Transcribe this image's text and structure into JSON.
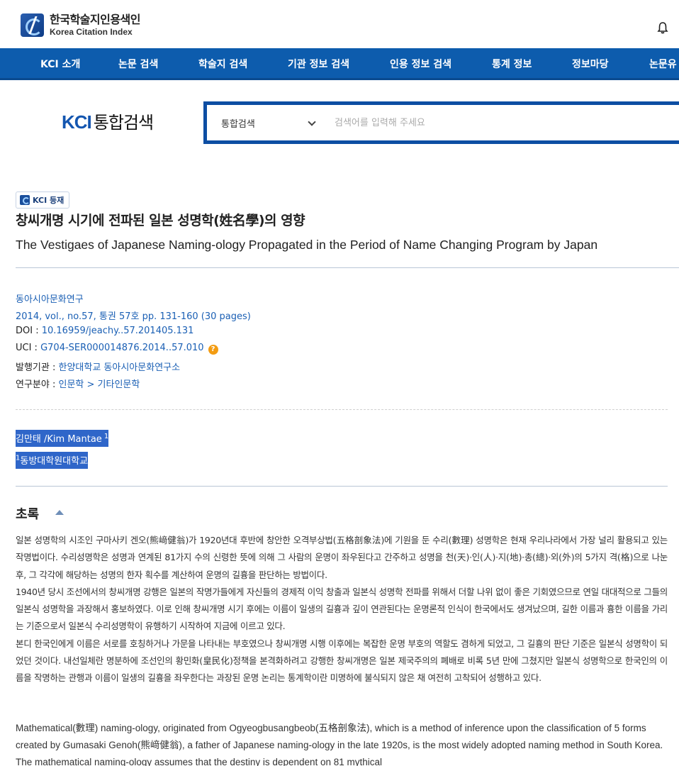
{
  "header": {
    "logo_ko": "한국학술지인용색인",
    "logo_en": "Korea Citation Index"
  },
  "nav": {
    "items": [
      "KCI 소개",
      "논문 검색",
      "학술지 검색",
      "기관 정보 검색",
      "인용 정보 검색",
      "통계 정보",
      "정보마당",
      "논문유"
    ]
  },
  "search": {
    "logo_kci": "KCI",
    "logo_text": "통합검색",
    "select_value": "통합검색",
    "placeholder": "검색어를 입력해 주세요"
  },
  "article": {
    "badge": "KCI 등재",
    "title_ko": "창씨개명 시기에 전파된 일본 성명학(姓名學)의 영향",
    "title_en": "The Vestigaes of Japanese Naming-ology Propagated in the Period of Name Changing Program by Japan",
    "journal": "동아시아문화연구",
    "issue": "2014, vol., no.57, 통권 57호 pp. 131-160 (30 pages)",
    "doi_label": "DOI : ",
    "doi": "10.16959/jeachy..57.201405.131",
    "uci_label": "UCI : ",
    "uci": "G704-SER000014876.2014..57.010",
    "publisher_label": "발행기관 : ",
    "publisher": "한양대학교 동아시아문화연구소",
    "field_label": "연구분야 : ",
    "field": "인문학 > 기타인문학",
    "author": "김만태 /Kim Mantae",
    "author_sup": "1",
    "affil_sup": "1",
    "affiliation": "동방대학원대학교"
  },
  "abstract": {
    "heading": "초록",
    "ko_p1": "일본 성명학의 시조인 구마사키 겐오(熊﨑健翁)가 1920년대 후반에 창안한 오격부상법(五格剖象法)에 기원을 둔 수리(數理) 성명학은 현재 우리나라에서 가장 널리 활용되고 있는 작명법이다. 수리성명학은 성명과 연계된 81가지 수의 신령한 뜻에 의해 그 사람의 운명이 좌우된다고 간주하고 성명을 천(天)·인(人)·지(地)·총(總)·외(外)의 5가지 격(格)으로 나눈 후, 그 각각에 해당하는 성명의 한자 획수를 계산하여 운명의 길흉을 판단하는 방법이다.",
    "ko_p2": "1940년 당시 조선에서의 창씨개명 강행은 일본의 작명가들에게 자신들의 경제적 이익 창출과 일본식 성명학 전파를 위해서 더할 나위 없이 좋은 기회였으므로 연일 대대적으로 그들의 일본식 성명학을 과장해서 홍보하였다. 이로 인해 창씨개명 시기 후에는 이름이 일생의 길흉과 깊이 연관된다는 운명론적 인식이 한국에서도 생겨났으며, 길한 이름과 흉한 이름을 가리는 기준으로서 일본식 수리성명학이 유행하기 시작하여 지금에 이르고 있다.",
    "ko_p3": "본디 한국인에게 이름은 서로를 호칭하거나 가문을 나타내는 부호였으나 창씨개명 시행 이후에는 복잡한 운명 부호의 역할도 겸하게 되었고, 그 길흉의 판단 기준은 일본식 성명학이 되었던 것이다. 내선일체란 명분하에 조선인의 황민화(皇民化)정책을 본격화하려고 강행한 창씨개명은 일본 제국주의의 폐배로 비록 5년 만에 그쳤지만 일본식 성명학으로 한국인의 이름을 작명하는 관행과 이름이 일생의 길흉을 좌우한다는 과장된 운명 논리는 통계학이란 미명하에 불식되지 않은 채 여전히 고착되어 성행하고 있다.",
    "en": "Mathematical(數理) naming-ology, originated from Ogyeogbusangbeob(五格剖象法), which is a method of inference upon the classification of 5 forms created by Gumasaki Genoh(熊﨑健翁), a father of Japanese naming-ology in the late 1920s, is the most widely adopted naming method in South Korea. The mathematical naming-ology assumes that the destiny is dependent on 81 mythical"
  }
}
